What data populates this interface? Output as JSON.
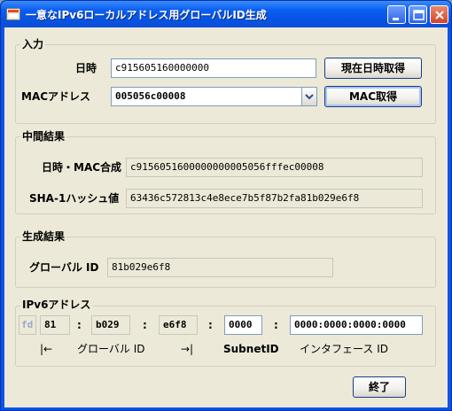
{
  "window": {
    "title": "一意なIPv6ローカルアドレス用グローバルID生成"
  },
  "input_group": {
    "title": "入力",
    "datetime_label": "日時",
    "datetime_value": "c915605160000000",
    "now_button": "現在日時取得",
    "mac_label": "MACアドレス",
    "mac_value": "005056c00008",
    "mac_button": "MAC取得"
  },
  "intermediate_group": {
    "title": "中間結果",
    "combined_label": "日時・MAC合成",
    "combined_value": "c9156051600000000005056fffec00008",
    "sha1_label": "SHA-1ハッシュ値",
    "sha1_value": "63436c572813c4e8ece7b5f87b2fa81b029e6f8"
  },
  "result_group": {
    "title": "生成結果",
    "global_id_label": "グローバル ID",
    "global_id_value": "81b029e6f8"
  },
  "ipv6_group": {
    "title": "IPv6アドレス",
    "prefix": "fd",
    "part1": "81",
    "part2": "b029",
    "part3": "e6f8",
    "subnet": "0000",
    "interface": "0000:0000:0000:0000",
    "colon": ":",
    "arrow_left": "|←",
    "global_id_caption": "グローバル ID",
    "arrow_right": "→|",
    "subnet_caption": "SubnetID",
    "interface_caption": "インタフェース ID"
  },
  "exit_button": "終了",
  "icons": [
    "app-icon",
    "minimize-icon",
    "maximize-icon",
    "close-icon",
    "chevron-down-icon"
  ],
  "colors": {
    "titlebar": "#0a5ef2",
    "client_bg": "#ece9d8",
    "field_border": "#7f9db9",
    "group_border": "#d0d0bf"
  }
}
